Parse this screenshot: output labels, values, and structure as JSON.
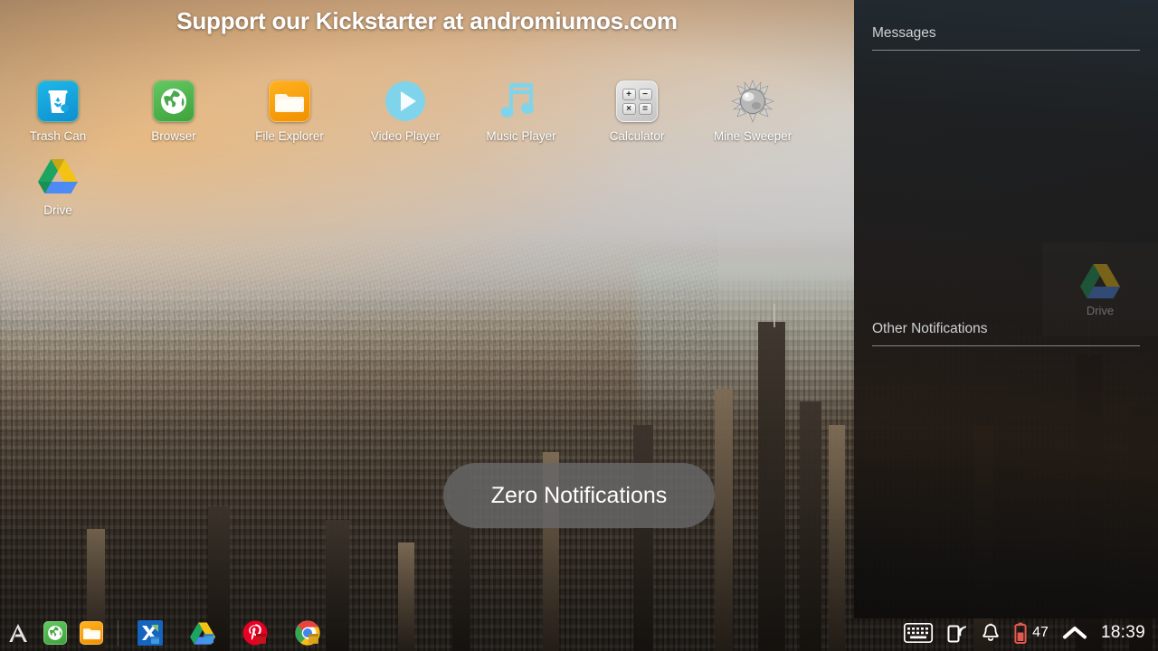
{
  "banner": {
    "text": "Support our Kickstarter at andromiumos.com"
  },
  "desktop": {
    "apps": [
      {
        "label": "Trash Can",
        "icon": "trash-can-icon"
      },
      {
        "label": "Browser",
        "icon": "browser-globe-icon"
      },
      {
        "label": "File Explorer",
        "icon": "folder-icon"
      },
      {
        "label": "Video Player",
        "icon": "play-circle-icon"
      },
      {
        "label": "Music Player",
        "icon": "music-note-icon"
      },
      {
        "label": "Calculator",
        "icon": "calculator-icon"
      },
      {
        "label": "Mine Sweeper",
        "icon": "mine-icon"
      },
      {
        "label": "Drive",
        "icon": "google-drive-icon"
      }
    ]
  },
  "notification_panel": {
    "messages_title": "Messages",
    "other_title": "Other Notifications",
    "messages_items": [],
    "other_items": [],
    "peek_card": {
      "label": "Drive",
      "icon": "google-drive-icon"
    }
  },
  "toast": {
    "text": "Zero Notifications"
  },
  "taskbar": {
    "launcher": {
      "name": "andromium-launcher",
      "label": "Andromium"
    },
    "pinned": [
      {
        "label": "Browser",
        "icon": "browser-globe-icon"
      },
      {
        "label": "File Explorer",
        "icon": "folder-icon"
      }
    ],
    "running": [
      {
        "label": "Sheets",
        "icon": "spreadsheet-icon"
      },
      {
        "label": "Drive",
        "icon": "google-drive-icon"
      },
      {
        "label": "Pinterest",
        "icon": "pin-circle-icon"
      },
      {
        "label": "Chrome",
        "icon": "chrome-icon"
      }
    ],
    "tray": {
      "keyboard": "keyboard-icon",
      "cast": "cast-phone-icon",
      "notifications": "bell-icon",
      "battery_icon": "battery-low-icon",
      "battery_level": "47",
      "expand": "chevron-up-icon",
      "clock": "18:39"
    }
  },
  "colors": {
    "accent_blue": "#7fd4ec",
    "browser_green": "#4aa84a",
    "folder_orange": "#f5a01e",
    "trash_blue": "#17a9e0",
    "battery_red": "#e4594f",
    "panel_bg": "#1b1f22",
    "toast_bg": "#666666",
    "text_white": "#ffffff"
  }
}
